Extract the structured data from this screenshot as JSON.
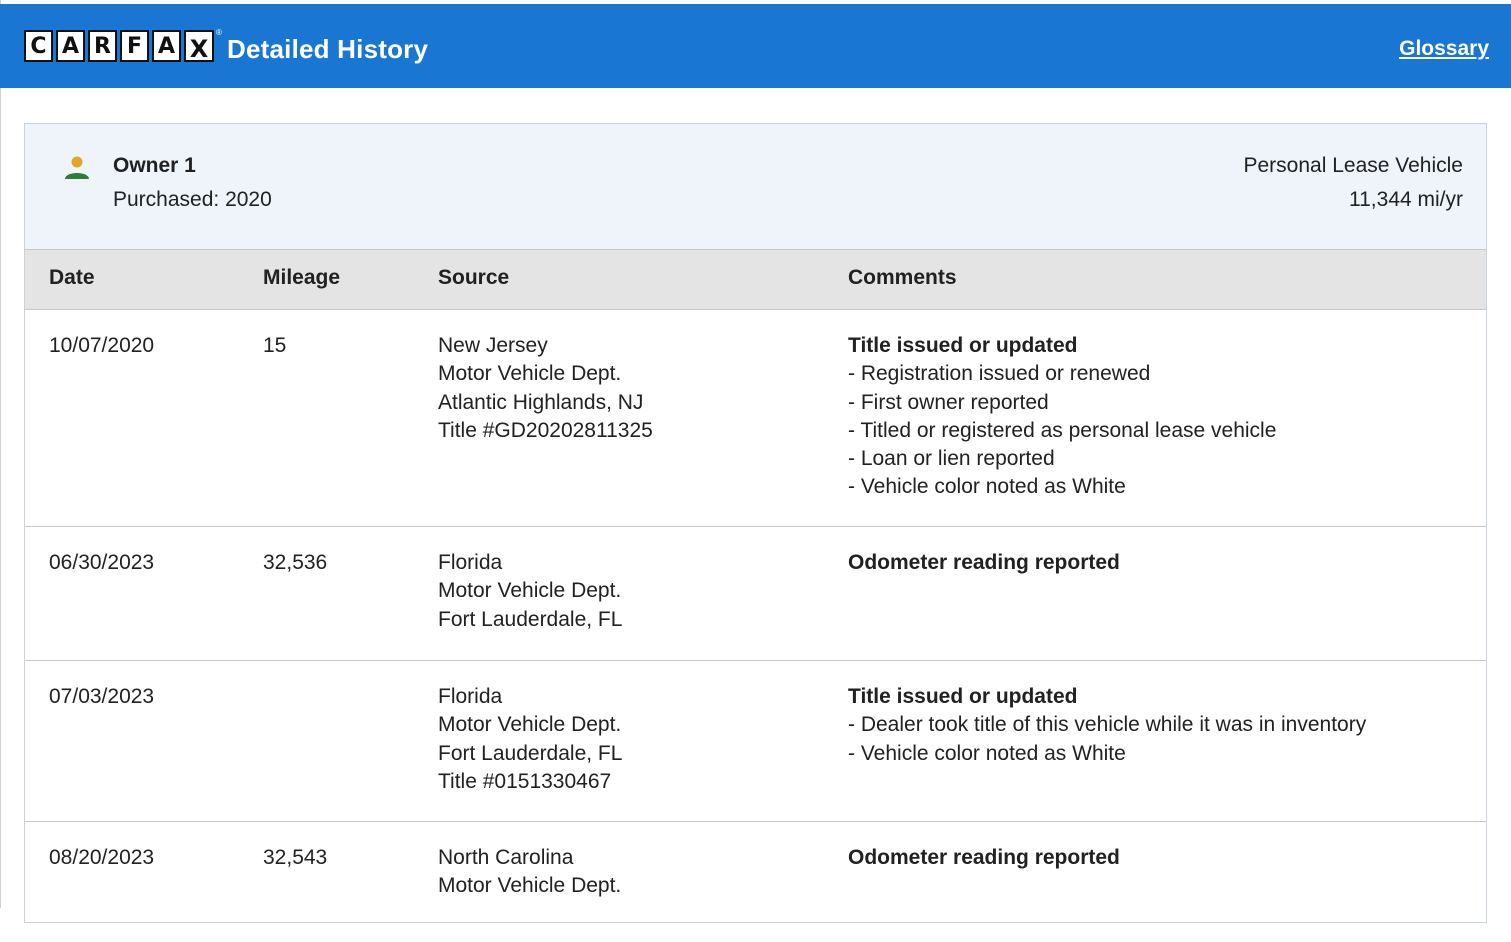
{
  "header": {
    "logo_letters": [
      "C",
      "A",
      "R",
      "F",
      "A",
      "X"
    ],
    "title": "Detailed History",
    "glossary_link": "Glossary",
    "bg_color": "#1976d2"
  },
  "owner": {
    "icon": "person-icon",
    "name": "Owner 1",
    "purchased": "Purchased: 2020",
    "type": "Personal Lease Vehicle",
    "miles_per_year": "11,344 mi/yr"
  },
  "table": {
    "columns": [
      "Date",
      "Mileage",
      "Source",
      "Comments"
    ],
    "rows": [
      {
        "date": "10/07/2020",
        "mileage": "15",
        "source": [
          "New Jersey",
          "Motor Vehicle Dept.",
          "Atlantic Highlands, NJ",
          "Title #GD20202811325"
        ],
        "comment_head": "Title issued or updated",
        "comment_items": [
          "Registration issued or renewed",
          "First owner reported",
          "Titled or registered as personal lease vehicle",
          "Loan or lien reported",
          "Vehicle color noted as White"
        ]
      },
      {
        "date": "06/30/2023",
        "mileage": "32,536",
        "source": [
          "Florida",
          "Motor Vehicle Dept.",
          "Fort Lauderdale, FL"
        ],
        "comment_head": "Odometer reading reported",
        "comment_items": []
      },
      {
        "date": "07/03/2023",
        "mileage": "",
        "source": [
          "Florida",
          "Motor Vehicle Dept.",
          "Fort Lauderdale, FL",
          "Title #0151330467"
        ],
        "comment_head": "Title issued or updated",
        "comment_items": [
          "Dealer took title of this vehicle while it was in inventory",
          "Vehicle color noted as White"
        ]
      },
      {
        "date": "08/20/2023",
        "mileage": "32,543",
        "source": [
          "North Carolina",
          "Motor Vehicle Dept."
        ],
        "comment_head": "Odometer reading reported",
        "comment_items": []
      }
    ]
  }
}
